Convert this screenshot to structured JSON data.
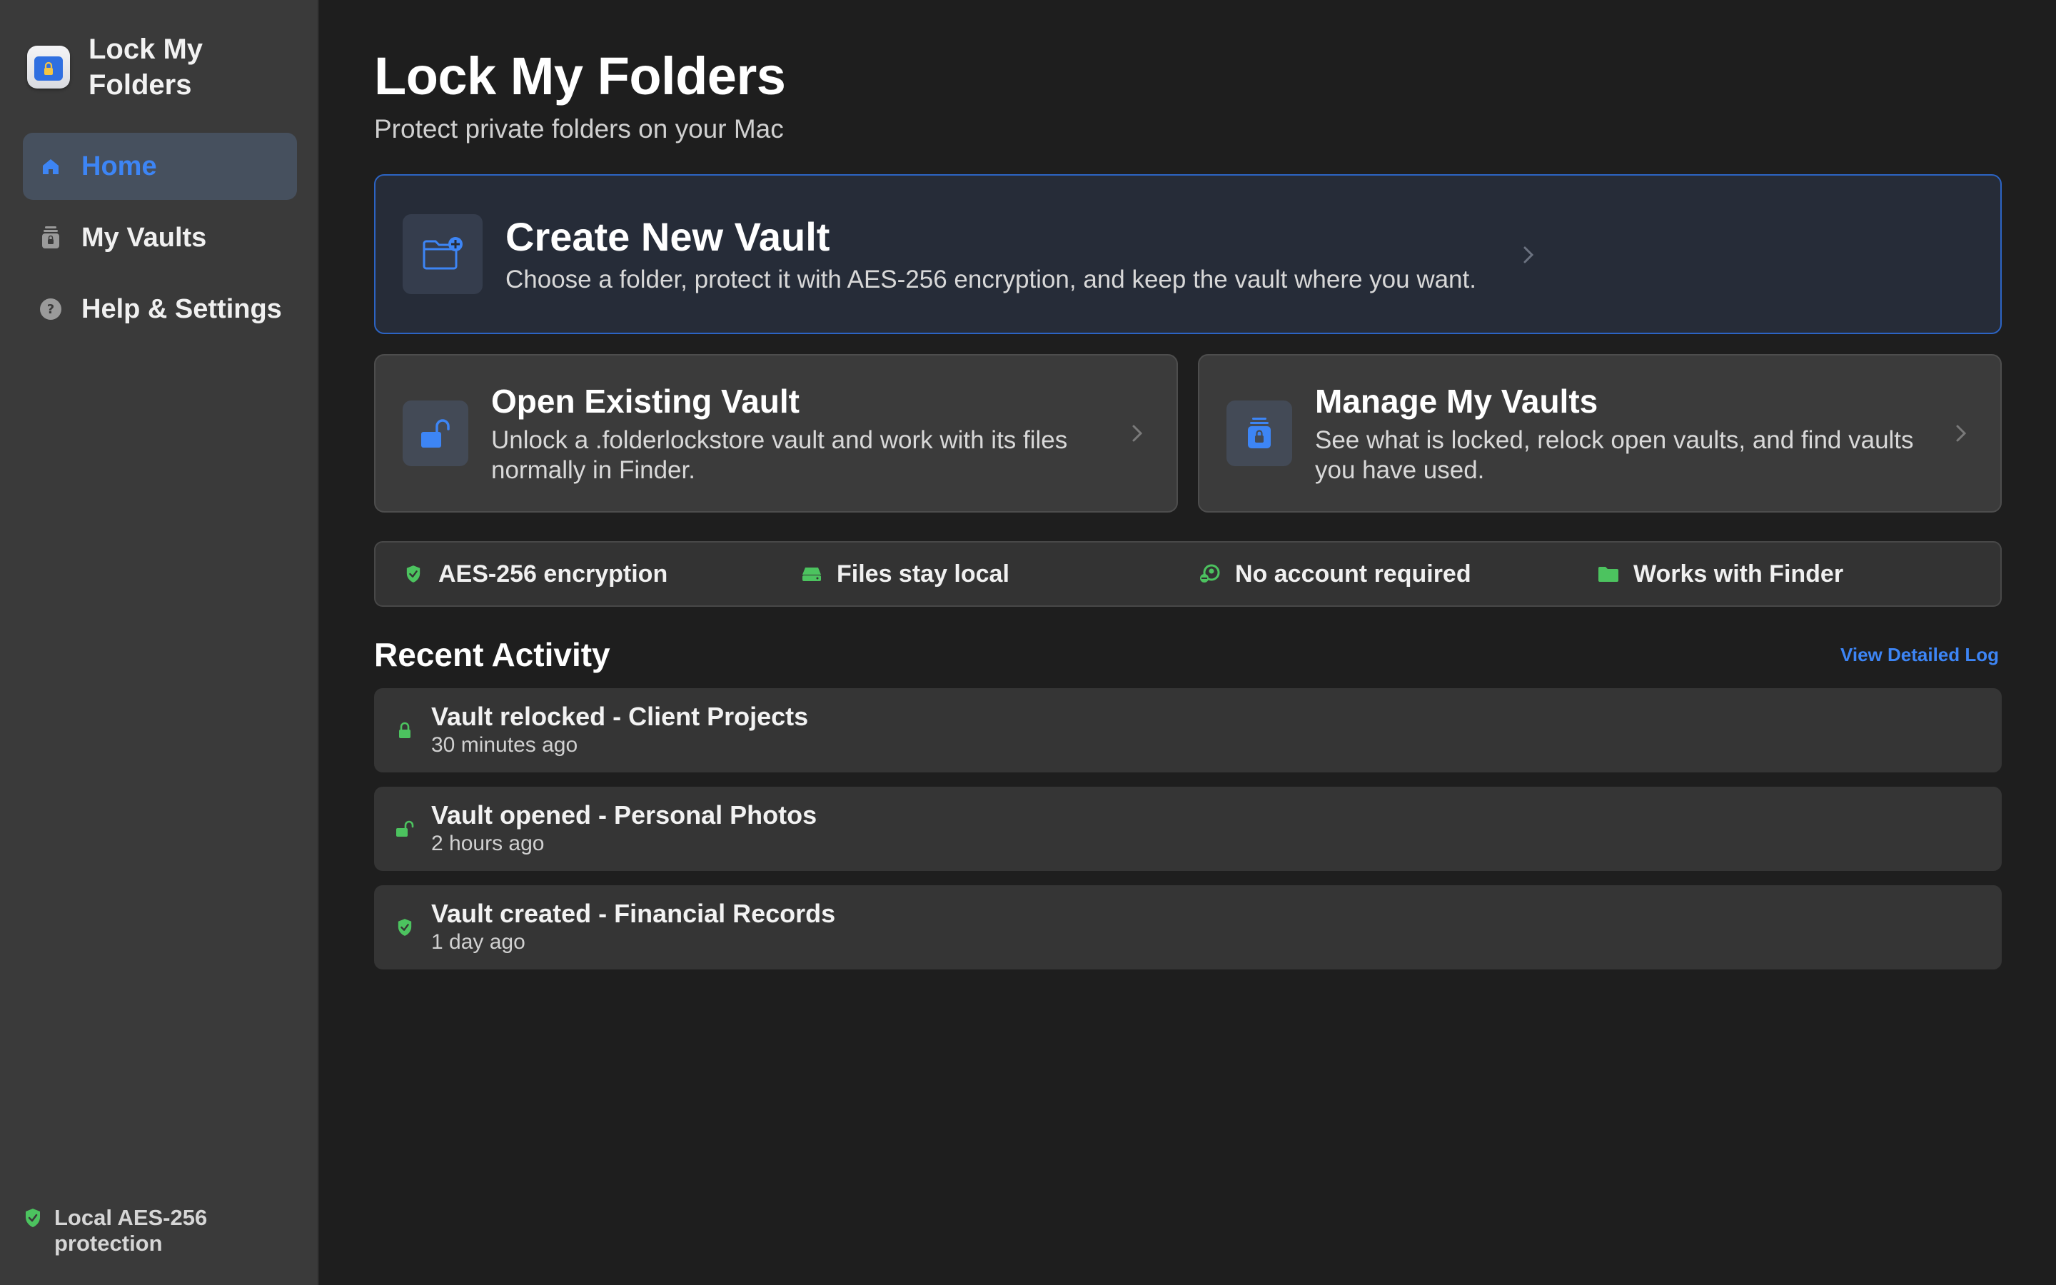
{
  "app": {
    "title": "Lock My Folders"
  },
  "sidebar": {
    "brand_title": "Lock My Folders",
    "items": [
      {
        "label": "Home",
        "icon": "house-icon",
        "active": true
      },
      {
        "label": "My Vaults",
        "icon": "vault-lock-icon",
        "active": false
      },
      {
        "label": "Help & Settings",
        "icon": "question-circle-icon",
        "active": false
      }
    ],
    "footer_text": "Local AES-256 protection"
  },
  "main": {
    "title": "Lock My Folders",
    "subtitle": "Protect private folders on your Mac",
    "create_card": {
      "title": "Create New Vault",
      "description": "Choose a folder, protect it with AES-256 encryption, and keep the vault where you want."
    },
    "open_card": {
      "title": "Open Existing Vault",
      "description": "Unlock a .folderlockstore vault and work with its files normally in Finder."
    },
    "manage_card": {
      "title": "Manage My Vaults",
      "description": "See what is locked, relock open vaults, and find vaults you have used."
    },
    "features": [
      {
        "label": "AES-256 encryption",
        "icon": "shield-check-icon"
      },
      {
        "label": "Files stay local",
        "icon": "drive-icon"
      },
      {
        "label": "No account required",
        "icon": "person-slash-icon"
      },
      {
        "label": "Works with Finder",
        "icon": "folder-icon"
      }
    ],
    "recent": {
      "title": "Recent Activity",
      "view_log_label": "View Detailed Log",
      "items": [
        {
          "title": "Vault relocked - Client Projects",
          "time": "30 minutes ago",
          "icon": "lock-icon"
        },
        {
          "title": "Vault opened - Personal Photos",
          "time": "2 hours ago",
          "icon": "unlock-icon"
        },
        {
          "title": "Vault created - Financial Records",
          "time": "1 day ago",
          "icon": "shield-check-icon"
        }
      ]
    }
  },
  "colors": {
    "accent": "#3d85f5",
    "success": "#4cc35f",
    "sidebar_bg": "#3a3a3a",
    "main_bg": "#1e1e1e"
  }
}
